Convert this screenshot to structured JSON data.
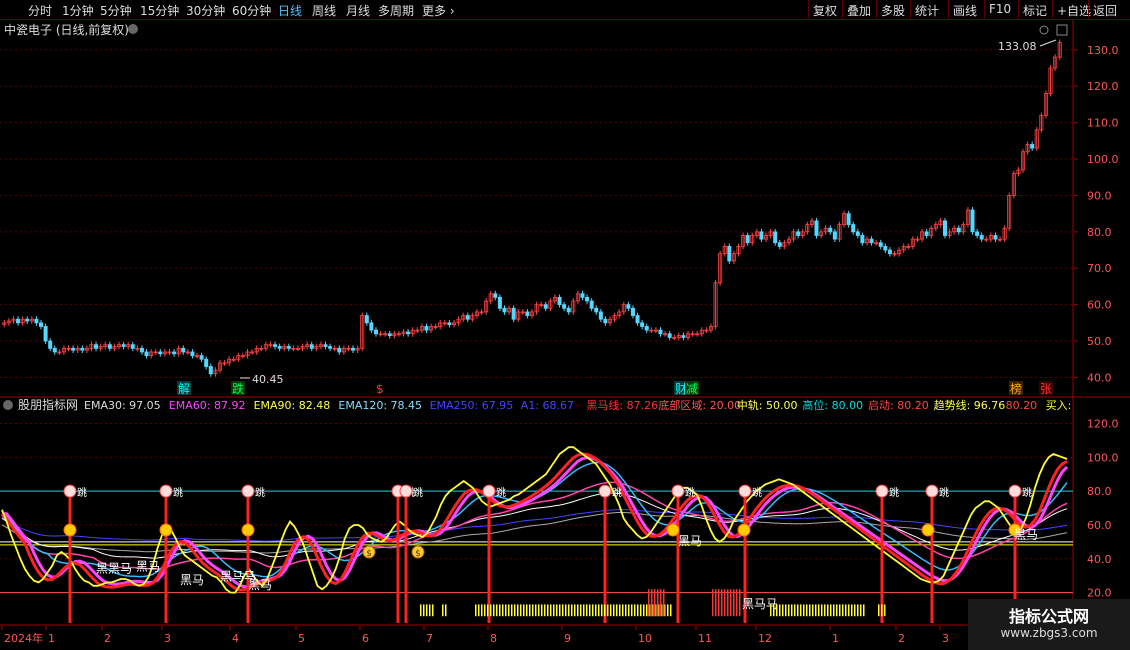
{
  "toolbar": {
    "periods": [
      "分时",
      "1分钟",
      "5分钟",
      "15分钟",
      "30分钟",
      "60分钟",
      "日线",
      "周线",
      "月线",
      "多周期",
      "更多"
    ],
    "active_period": "日线",
    "buttons": [
      "复权",
      "叠加",
      "多股",
      "统计",
      "画线",
      "F10",
      "标记",
      "+自选",
      "返回"
    ]
  },
  "colors": {
    "candle_up": "#ff4444",
    "candle_down": "#54d8ff",
    "grid": "#5a0000",
    "ema30": "#ffffff",
    "ema60": "#ff44ff",
    "ema90": "#ffff44",
    "ema120": "#88ddff",
    "ema250": "#3333ff",
    "black_horse": "#ff2222",
    "trend": "#ffff00",
    "mid": "#ffffff",
    "high": "#00dddd"
  },
  "chart_data": [
    {
      "type": "candlestick",
      "title": "中瓷电子 (日线,前复权)",
      "y_ticks": [
        40,
        50,
        60,
        70,
        80,
        90,
        100,
        110,
        120,
        130
      ],
      "ylim": [
        36,
        136
      ],
      "annotations": {
        "high_label": "133.08",
        "low_label": "40.45"
      },
      "markers": [
        "解",
        "跌",
        "$",
        "财",
        "减",
        "榜",
        "张"
      ],
      "close": [
        55,
        55.5,
        56,
        55,
        56,
        55.5,
        56,
        55,
        54,
        50,
        48,
        47,
        47,
        48,
        48,
        47.5,
        48,
        47.5,
        48,
        49,
        48,
        48.5,
        49,
        48,
        48.5,
        49,
        48.5,
        49,
        48,
        48,
        47,
        46,
        47,
        47,
        46.5,
        47,
        47,
        46.5,
        48,
        47,
        47,
        46,
        46,
        45,
        43,
        41,
        42,
        44,
        44,
        45,
        45,
        46,
        46,
        47,
        47,
        48,
        48,
        49,
        49,
        48.5,
        48,
        48.5,
        48,
        48,
        48,
        48.5,
        49,
        48,
        48.5,
        49,
        48.5,
        48,
        48,
        47,
        48,
        48,
        47.5,
        48,
        57,
        55,
        53,
        52,
        52,
        52,
        51.5,
        52,
        52,
        52.5,
        52,
        53,
        53,
        54,
        53,
        54,
        54,
        55,
        55,
        54.5,
        55,
        56,
        57,
        56,
        57,
        58,
        58,
        61,
        63,
        62,
        59,
        58,
        59,
        56,
        58,
        58,
        57,
        58,
        60,
        60,
        59,
        61,
        62,
        60,
        59,
        58,
        61,
        63,
        62,
        61,
        59,
        58,
        56,
        55,
        56,
        57,
        58,
        60,
        59,
        57,
        55,
        54,
        53,
        53,
        53,
        52,
        52,
        51,
        51,
        51.5,
        51,
        52,
        52,
        52,
        53,
        53,
        54,
        66,
        74,
        76,
        72,
        74,
        76,
        79,
        77,
        79,
        80,
        78,
        79,
        80,
        77,
        76,
        77,
        78,
        80,
        79,
        80,
        82,
        83,
        79,
        80,
        81,
        80,
        78,
        82,
        85,
        82,
        80,
        79,
        77,
        78,
        77,
        77,
        76,
        75,
        74,
        74,
        75,
        76,
        76,
        78,
        78,
        80,
        79,
        81,
        82,
        83,
        79,
        80,
        81,
        80,
        82,
        86,
        80,
        79,
        78,
        78,
        79,
        78,
        78,
        81,
        90,
        96,
        97,
        102,
        104,
        103,
        108,
        112,
        118,
        125,
        128,
        132
      ]
    },
    {
      "type": "line",
      "title": "股朋指标网",
      "y_ticks": [
        20,
        40,
        60,
        80,
        100,
        120
      ],
      "ylim": [
        2,
        128
      ],
      "legend": [
        {
          "label": "EMA30:",
          "value": "97.05"
        },
        {
          "label": "EMA60:",
          "value": "87.92"
        },
        {
          "label": "EMA90:",
          "value": "82.48"
        },
        {
          "label": "EMA120:",
          "value": "78.45"
        },
        {
          "label": "EMA250:",
          "value": "67.95"
        },
        {
          "label": "A1:",
          "value": "68.67"
        },
        {
          "label": "黑马线:",
          "value": "87.26"
        },
        {
          "label": "底部区域:",
          "value": "20.00"
        },
        {
          "label": "中轨:",
          "value": "50.00"
        },
        {
          "label": "高位:",
          "value": "80.00"
        },
        {
          "label": "启动:",
          "value": "80.20"
        },
        {
          "label": "趋势线:",
          "value": "96.76"
        },
        {
          "label": "",
          "value": "80.20"
        },
        {
          "label": "买入:",
          "value": ""
        }
      ],
      "levels": {
        "bottom_zone": 20,
        "mid": 50,
        "high": 80
      },
      "marker_text": {
        "jump": "跳",
        "horse": "黑马",
        "double_horse": "黑黑马",
        "combo": "黑马马",
        "coin": "$"
      },
      "series": {
        "ema_yellow": [
          67,
          60,
          52,
          45,
          38,
          32,
          28,
          25,
          24,
          26,
          30,
          34,
          40,
          42,
          40,
          37,
          32,
          28,
          25,
          24,
          22,
          22,
          23,
          24,
          24,
          25,
          26,
          26,
          25,
          23,
          22,
          23,
          27,
          34,
          44,
          52,
          56,
          55,
          50,
          44,
          40,
          38,
          36,
          34,
          32,
          30,
          28,
          27,
          24,
          20,
          18,
          18,
          22,
          28,
          32,
          28,
          24,
          22,
          26,
          33,
          40,
          48,
          55,
          60,
          57,
          52,
          46,
          38,
          30,
          22,
          20,
          22,
          26,
          32,
          40,
          50,
          56,
          58,
          58,
          56,
          52,
          50,
          49,
          48,
          50,
          54,
          58,
          60,
          58,
          55,
          53,
          52,
          51,
          53,
          58,
          63,
          70,
          75,
          78,
          80,
          82,
          84,
          82,
          80,
          76,
          72,
          70,
          69,
          70,
          71,
          72,
          73,
          75,
          76,
          78,
          80,
          82,
          84,
          86,
          88,
          92,
          96,
          100,
          102,
          104,
          104,
          102,
          100,
          98,
          96,
          94,
          90,
          86,
          82,
          76,
          70,
          62,
          58,
          55,
          52,
          50,
          51,
          54,
          58,
          62,
          66,
          70,
          74,
          78,
          80,
          80,
          78,
          76,
          70,
          62,
          55,
          50,
          48,
          50,
          54,
          60,
          64,
          68,
          72,
          75,
          78,
          80,
          82,
          83,
          84,
          85,
          84,
          83,
          82,
          80,
          78,
          76,
          74,
          72,
          70,
          68,
          66,
          64,
          62,
          60,
          58,
          56,
          54,
          52,
          50,
          48,
          46,
          44,
          42,
          40,
          38,
          36,
          34,
          32,
          30,
          28,
          26,
          25,
          24,
          24,
          25,
          28,
          34,
          40,
          46,
          52,
          58,
          64,
          68,
          70,
          72,
          72,
          70,
          68,
          64,
          60,
          56,
          54,
          56,
          62,
          70,
          80,
          88,
          94,
          98,
          100,
          99,
          98,
          97
        ]
      },
      "jump_marker_count": 12,
      "last_label": "黑马"
    }
  ],
  "x_axis": {
    "labels": [
      "2024年",
      "1",
      "2",
      "3",
      "4",
      "5",
      "6",
      "7",
      "8",
      "9",
      "10",
      "11",
      "12",
      "1",
      "2",
      "3"
    ]
  },
  "watermark": {
    "line1": "指标公式网",
    "line2": "www.zbgs3.com"
  }
}
